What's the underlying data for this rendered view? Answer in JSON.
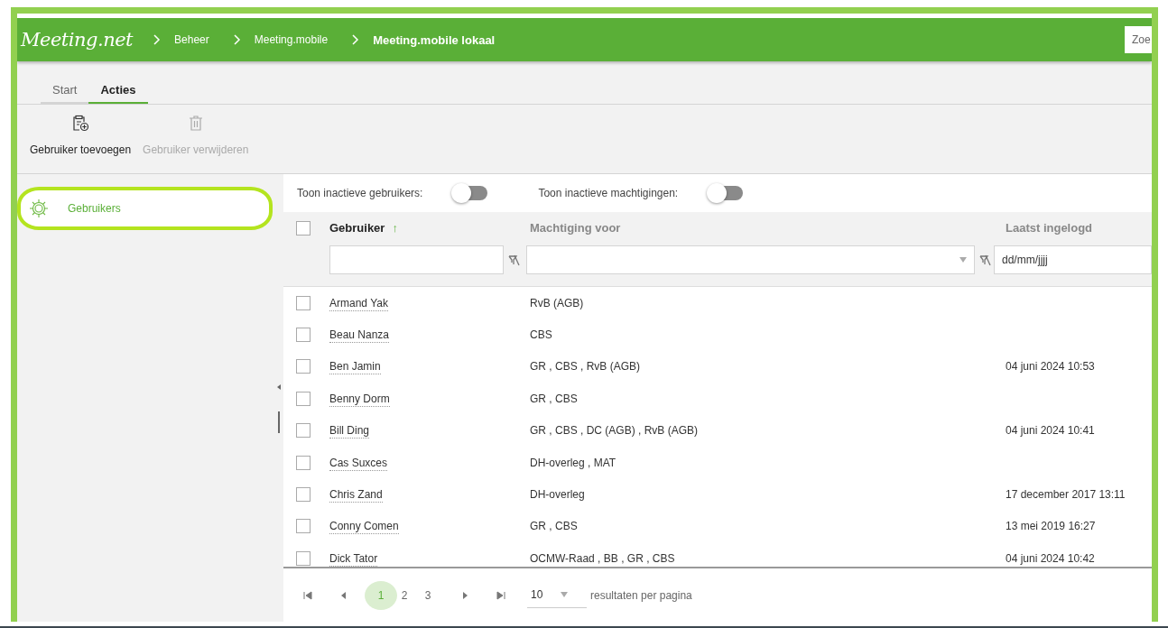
{
  "header": {
    "logo": "Meeting.net",
    "breadcrumb": [
      {
        "label": "Beheer",
        "current": false
      },
      {
        "label": "Meeting.mobile",
        "current": false
      },
      {
        "label": "Meeting.mobile lokaal",
        "current": true
      }
    ],
    "search": {
      "placeholder": "Zoe"
    }
  },
  "tabs": [
    {
      "label": "Start",
      "selected": false
    },
    {
      "label": "Acties",
      "selected": true
    }
  ],
  "toolbar": [
    {
      "kind": "add",
      "label": "Gebruiker toevoegen",
      "disabled": false
    },
    {
      "kind": "delete",
      "label": "Gebruiker verwijderen",
      "disabled": true
    }
  ],
  "sidebar": {
    "items": [
      {
        "label": "Gebruikers",
        "selected": true
      }
    ]
  },
  "toggles": [
    {
      "label": "Toon inactieve gebruikers:",
      "on": false
    },
    {
      "label": "Toon inactieve machtigingen:",
      "on": false
    }
  ],
  "table": {
    "select_all": {
      "checked": false
    },
    "columns": [
      {
        "label": "Gebruiker",
        "sort_icon": "↑",
        "filter": {
          "kind": "text"
        }
      },
      {
        "label": "Machtiging voor",
        "filter": {
          "kind": "select"
        }
      },
      {
        "label": "Laatst ingelogd",
        "filter": {
          "kind": "date",
          "placeholder": "dd/mm/jjjj"
        }
      }
    ],
    "rows": [
      {
        "checked": false,
        "user": "Armand Yak",
        "rights": "RvB (AGB)"
      },
      {
        "checked": false,
        "user": "Beau Nanza",
        "rights": "CBS"
      },
      {
        "checked": false,
        "user": "Ben Jamin",
        "rights": "GR , CBS , RvB (AGB)",
        "last_login": "04 juni 2024 10:53"
      },
      {
        "checked": false,
        "user": "Benny Dorm",
        "rights": "GR , CBS"
      },
      {
        "checked": false,
        "user": "Bill Ding",
        "rights": "GR , CBS , DC (AGB) , RvB (AGB)",
        "last_login": "04 juni 2024 10:41"
      },
      {
        "checked": false,
        "user": "Cas Suxces",
        "rights": "DH-overleg , MAT"
      },
      {
        "checked": false,
        "user": "Chris Zand",
        "rights": "DH-overleg",
        "last_login": "17 december 2017 13:11"
      },
      {
        "checked": false,
        "user": "Conny Comen",
        "rights": "GR , CBS",
        "last_login": "13 mei 2019 16:27"
      },
      {
        "checked": false,
        "user": "Dick Tator",
        "rights": "OCMW-Raad , BB , GR , CBS",
        "last_login": "04 juni 2024 10:42"
      }
    ]
  },
  "pager": {
    "pages": [
      {
        "label": "1",
        "selected": true
      },
      {
        "label": "2",
        "selected": false
      },
      {
        "label": "3",
        "selected": false
      }
    ],
    "page_size": "10",
    "page_size_label": "resultaten per pagina"
  }
}
